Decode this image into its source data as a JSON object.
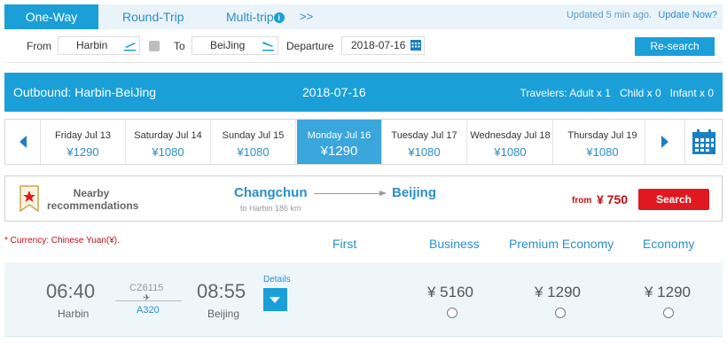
{
  "tabs": {
    "one_way": "One-Way",
    "round_trip": "Round-Trip",
    "multi_trip": "Multi-trip",
    "multi_trip_info": "i",
    "more": ">>"
  },
  "update": {
    "updated": "Updated 5 min ago.",
    "update_now": "Update Now?"
  },
  "search": {
    "from_label": "From",
    "from_value": "Harbin",
    "to_label": "To",
    "to_value": "BeiJing",
    "departure_label": "Departure",
    "departure_value": "2018-07-16",
    "research_button": "Re-search"
  },
  "outbound": {
    "title": "Outbound: Harbin-BeiJing",
    "date": "2018-07-16",
    "travelers_adult": "Travelers: Adult x 1",
    "travelers_child": "Child x 0",
    "travelers_infant": "Infant x 0"
  },
  "dates": [
    {
      "day": "Friday  Jul 13",
      "price": "¥1290"
    },
    {
      "day": "Saturday  Jul 14",
      "price": "¥1080"
    },
    {
      "day": "Sunday  Jul 15",
      "price": "¥1080"
    },
    {
      "day": "Monday  Jul 16",
      "price": "¥1290"
    },
    {
      "day": "Tuesday  Jul 17",
      "price": "¥1080"
    },
    {
      "day": "Wednesday  Jul 18",
      "price": "¥1080"
    },
    {
      "day": "Thursday  Jul 19",
      "price": "¥1080"
    }
  ],
  "recommendation": {
    "label_line1": "Nearby",
    "label_line2": "recommendations",
    "from_city": "Changchun",
    "from_sub": "to Harbin 186 km",
    "to_city": "Beijing",
    "price_label": "from",
    "price": "¥ 750",
    "search_button": "Search"
  },
  "fares_header": {
    "currency_note": "* Currency:  Chinese Yuan(¥).",
    "first": "First",
    "business": "Business",
    "premium_economy": "Premium Economy",
    "economy": "Economy"
  },
  "flight": {
    "dep_time": "06:40",
    "dep_city": "Harbin",
    "flight_no": "CZ6115",
    "plane_glyph": "✈",
    "aircraft": "A320",
    "arr_time": "08:55",
    "arr_city": "Beijing",
    "details": "Details",
    "business_price": "¥ 5160",
    "premium_price": "¥ 1290",
    "economy_price": "¥ 1290"
  },
  "colors": {
    "primary": "#1a9fd8",
    "accent_red": "#e0181f",
    "price_red": "#c40d14"
  }
}
